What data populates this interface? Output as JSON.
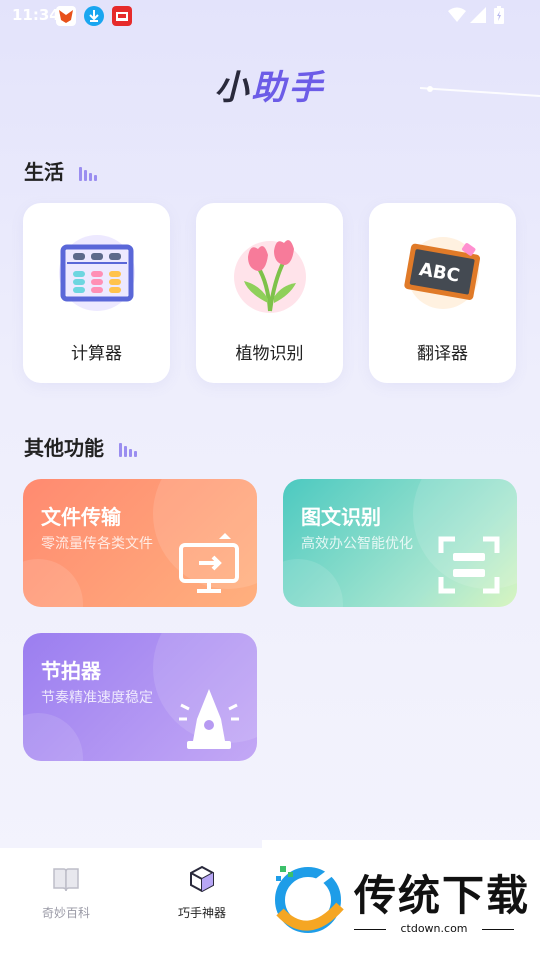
{
  "status_bar": {
    "time": "11:34",
    "notification_icons": [
      "fox-app-icon",
      "download-icon",
      "store-app-icon"
    ],
    "system_icons": [
      "wifi-icon",
      "signal-icon",
      "battery-icon"
    ]
  },
  "app_title": {
    "part1": "小",
    "part2": "助手"
  },
  "life_section": {
    "title": "生活",
    "cards": [
      {
        "label": "计算器",
        "icon": "abacus-icon"
      },
      {
        "label": "植物识别",
        "icon": "tulip-icon"
      },
      {
        "label": "翻译器",
        "icon": "chalkboard-abc-icon"
      }
    ]
  },
  "other_section": {
    "title": "其他功能",
    "features": [
      {
        "title": "文件传输",
        "subtitle": "零流量传各类文件",
        "icon": "file-transfer-icon",
        "color": "#ff8a70"
      },
      {
        "title": "图文识别",
        "subtitle": "高效办公智能优化",
        "icon": "scan-icon",
        "color": "#4cc9c0"
      },
      {
        "title": "节拍器",
        "subtitle": "节奏精准速度稳定",
        "icon": "metronome-icon",
        "color": "#9b7ef0"
      }
    ]
  },
  "tab_bar": {
    "tabs": [
      {
        "label": "奇妙百科",
        "icon": "book-icon",
        "active": false
      },
      {
        "label": "巧手神器",
        "icon": "cube-icon",
        "active": true
      }
    ]
  },
  "watermark": {
    "text": "传统下载",
    "url": "ctdown.com"
  }
}
